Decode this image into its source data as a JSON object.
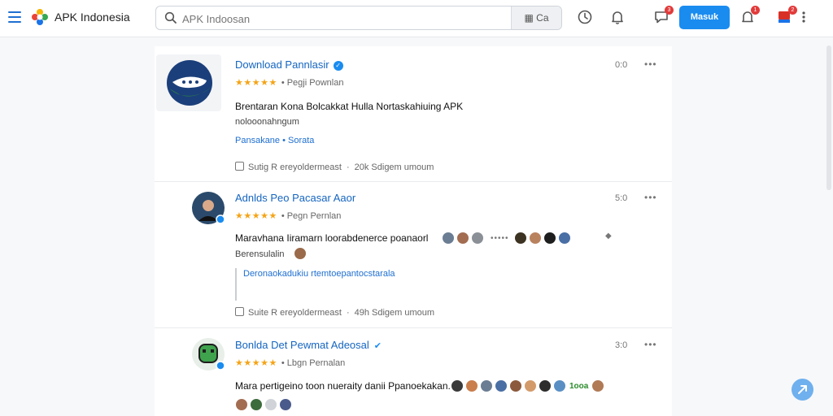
{
  "app": {
    "title": "APK Indonesia"
  },
  "search": {
    "placeholder": "APK Indoosan",
    "filter_label": "Ca"
  },
  "toolbar": {
    "signin_label": "Masuk",
    "badge_1": "3",
    "badge_2": "1",
    "badge_3": "2"
  },
  "posts": [
    {
      "name": "Download Pannlasir",
      "stars": "★★★★★",
      "meta": "• Pegji Pownlan",
      "time": "0:0",
      "body": "Brentaran Kona Bolcakkat Hulla Nortaskahiuing APK",
      "sub": "nolooonahngum",
      "link": "Pansakane • Sorata",
      "footer_a": "Sutig R ereyoldermeast",
      "footer_b": "20k Sdigem umoum"
    },
    {
      "name": "Adnlds Peo Pacasar Aaor",
      "stars": "★★★★★",
      "meta": "• Pegn Pernlan",
      "time": "5:0",
      "body": "Maravhana Iiramarn loorabdenerce poanaorl",
      "sub": "Berensulalin",
      "quote": "Deronaokadukiu rtemtoepantocstarala",
      "footer_a": "Suite R ereyoldermeast",
      "footer_b": "49h Sdigem umoum"
    },
    {
      "name": "Bonlda Det Pewmat Adeosal",
      "stars": "★★★★★",
      "meta": "• Lbgn Pernalan",
      "time": "3:0",
      "body": "Mara pertigeino toon nueraity danii Ppanoekakan...",
      "count": "1ooa"
    }
  ],
  "colors": {
    "accent": "#1a8cf0",
    "link": "#1565c0",
    "star": "#f4a416",
    "badge": "#e23b3b"
  }
}
